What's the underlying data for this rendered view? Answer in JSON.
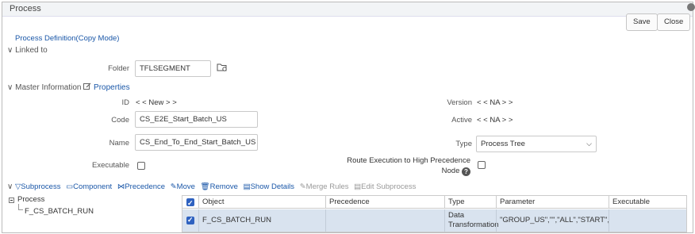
{
  "window": {
    "title": "Process"
  },
  "toolbar": {
    "save_label": "Save",
    "close_label": "Close"
  },
  "breadcrumb": "Process Definition(Copy Mode)",
  "linked_to": {
    "section_label": "Linked to",
    "folder_label": "Folder",
    "folder_value": "TFLSEGMENT"
  },
  "master": {
    "section_label": "Master Information",
    "properties_label": "Properties",
    "id_label": "ID",
    "id_value": "< < New > >",
    "version_label": "Version",
    "version_value": "< < NA > >",
    "code_label": "Code",
    "code_value": "CS_E2E_Start_Batch_US",
    "active_label": "Active",
    "active_value": "< < NA > >",
    "name_label": "Name",
    "name_value": "CS_End_To_End_Start_Batch_US",
    "type_label": "Type",
    "type_value": "Process Tree",
    "executable_label": "Executable",
    "executable_checked": false,
    "route_label_line1": "Route Execution to High Precedence",
    "route_label_line2": "Node",
    "route_checked": false
  },
  "subprocess_toolbar": {
    "subprocess": "Subprocess",
    "component": "Component",
    "precedence": "Precedence",
    "move": "Move",
    "remove": "Remove",
    "show_details": "Show Details",
    "merge_rules": "Merge Rules",
    "edit_subprocess": "Edit Subprocess"
  },
  "tree": {
    "root": "Process",
    "child": "F_CS_BATCH_RUN"
  },
  "grid": {
    "columns": [
      "Object",
      "Precedence",
      "Type",
      "Parameter",
      "Executable"
    ],
    "rows": [
      {
        "object": "F_CS_BATCH_RUN",
        "precedence": "",
        "type_line1": "Data",
        "type_line2": "Transformation",
        "parameter": "\"GROUP_US\",\"\",\"ALL\",\"START\",\"US\"",
        "executable": "",
        "checked": true
      }
    ]
  },
  "colors": {
    "link": "#1a57a8",
    "selected_row": "#d9e3ef",
    "checkbox_on": "#2f62c0"
  }
}
